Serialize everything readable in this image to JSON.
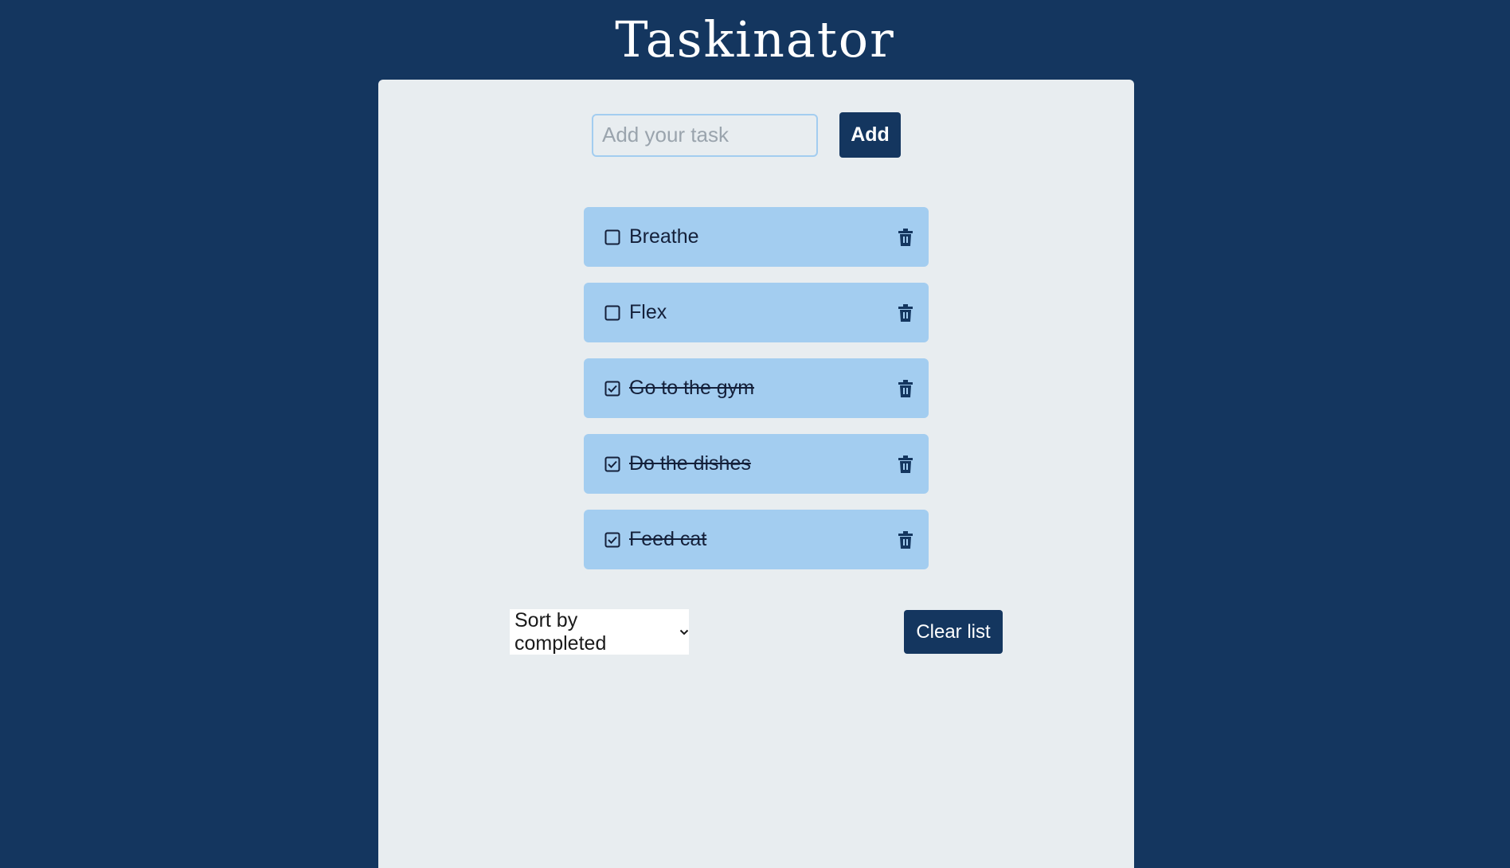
{
  "app": {
    "title": "Taskinator"
  },
  "add_form": {
    "placeholder": "Add your task",
    "value": "",
    "add_label": "Add"
  },
  "tasks": [
    {
      "label": "Breathe",
      "completed": false
    },
    {
      "label": "Flex",
      "completed": false
    },
    {
      "label": "Go to the gym",
      "completed": true
    },
    {
      "label": "Do the dishes",
      "completed": true
    },
    {
      "label": "Feed cat",
      "completed": true
    }
  ],
  "controls": {
    "sort_selected": "Sort by completed",
    "clear_label": "Clear list"
  },
  "icons": {
    "checkbox_unchecked": "square-icon",
    "checkbox_checked": "check-square-icon",
    "delete": "trash-icon",
    "dropdown": "chevron-down-icon"
  },
  "colors": {
    "background": "#14365f",
    "panel": "#e8edf0",
    "task_item": "#a3cdf0",
    "primary_button": "#14365f"
  }
}
